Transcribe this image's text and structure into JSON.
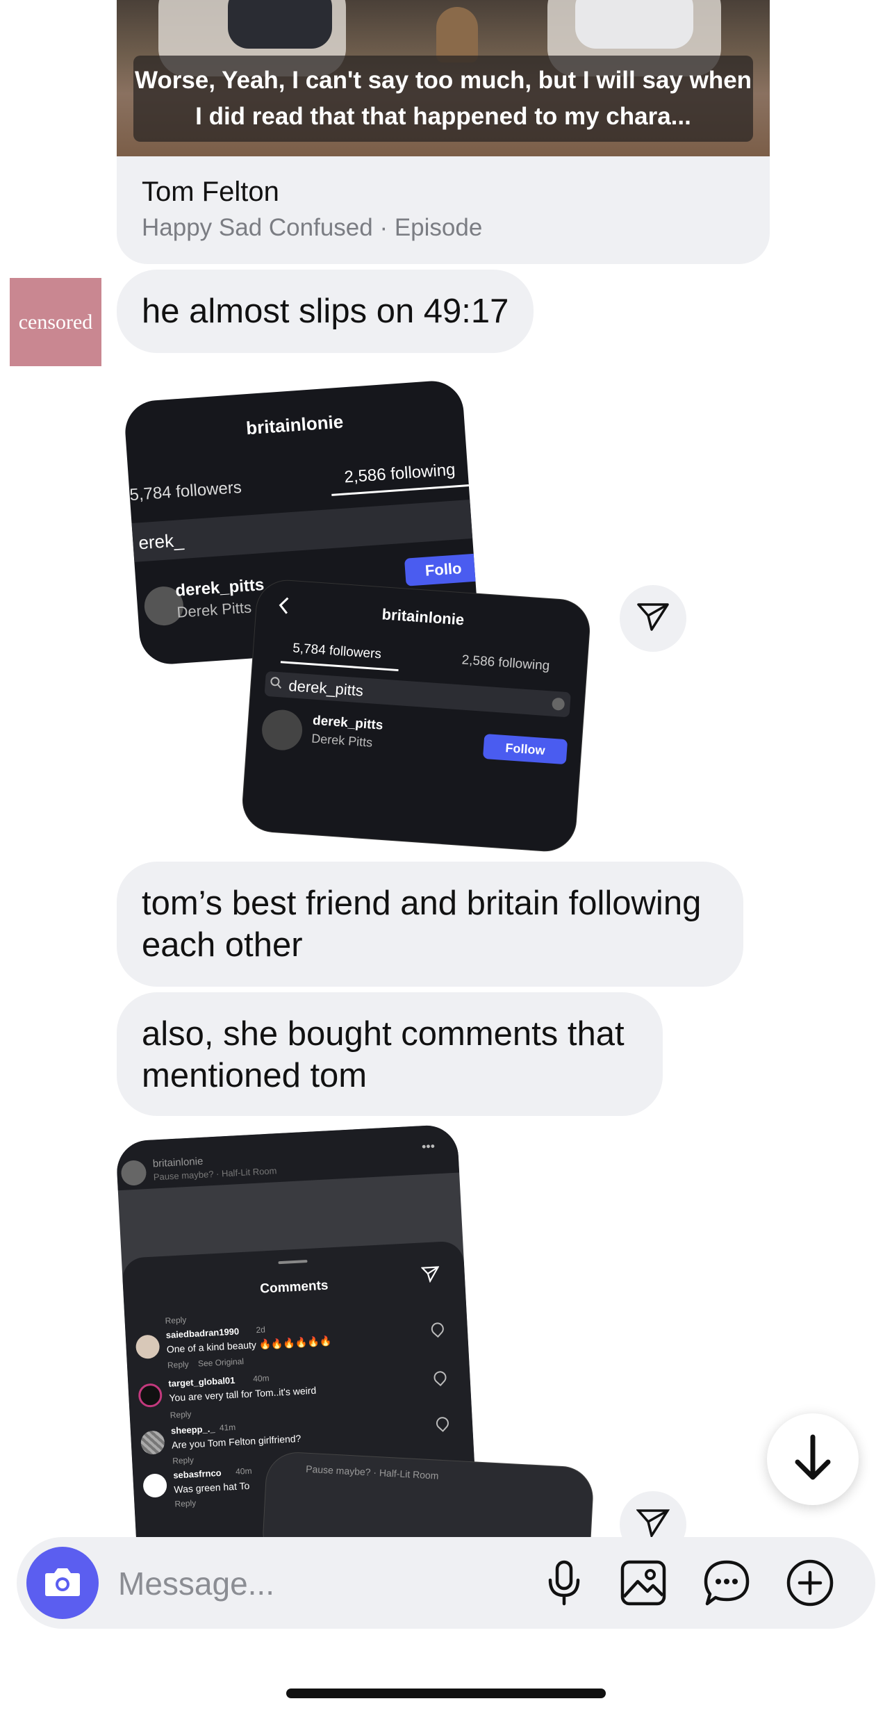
{
  "shared_post": {
    "caption": "Worse, Yeah, I can't say too much, but I will say when I did read that that happened to my chara...",
    "title": "Tom Felton",
    "subtitle": "Happy Sad Confused · Episode"
  },
  "avatar": {
    "label": "censored"
  },
  "messages": [
    "he almost slips on 49:17",
    "tom’s best friend and britain following each other",
    "also, she bought comments that mentioned tom"
  ],
  "screenshot1_back": {
    "username": "britainlonie",
    "followers": "5,784 followers",
    "following": "2,586 following",
    "search": "erek_",
    "result_user": "derek_pitts",
    "result_name": "Derek Pitts",
    "follow": "Follo"
  },
  "screenshot1_front": {
    "username": "britainlonie",
    "followers": "5,784 followers",
    "following": "2,586 following",
    "search": "derek_pitts",
    "result_user": "derek_pitts",
    "result_name": "Derek Pitts",
    "follow": "Follow"
  },
  "screenshot2": {
    "username": "britainlonie",
    "song": "Pause maybe? · Half-Lit Room",
    "header": "Comments",
    "top_reply": "Reply",
    "comments": [
      {
        "user": "saiedbadran1990",
        "time": "2d",
        "text": "One of a kind beauty 🔥🔥🔥🔥🔥🔥",
        "actions": "Reply    See Original"
      },
      {
        "user": "target_global01",
        "time": "40m",
        "text": "You are very tall for Tom..it's weird",
        "actions": "Reply"
      },
      {
        "user": "sheepp_._",
        "time": "41m",
        "text": "Are you Tom Felton girlfriend?",
        "actions": "Reply"
      },
      {
        "user": "sebasfrnco",
        "time": "40m",
        "text": "Was green hat To",
        "actions": "Reply"
      }
    ],
    "overlay_song": "Pause maybe? · Half-Lit Room"
  },
  "composer": {
    "placeholder": "Message...",
    "value": ""
  },
  "colors": {
    "accent": "#5b5ef0",
    "bubble": "#eff0f3",
    "follow": "#4a5cf0",
    "avatar": "#c98791"
  },
  "icons": {
    "share": "paper-plane-icon",
    "camera": "camera-icon",
    "mic": "microphone-icon",
    "gallery": "image-icon",
    "sticker": "chat-bubble-icon",
    "add": "plus-circle-icon",
    "scroll": "arrow-down-icon"
  }
}
